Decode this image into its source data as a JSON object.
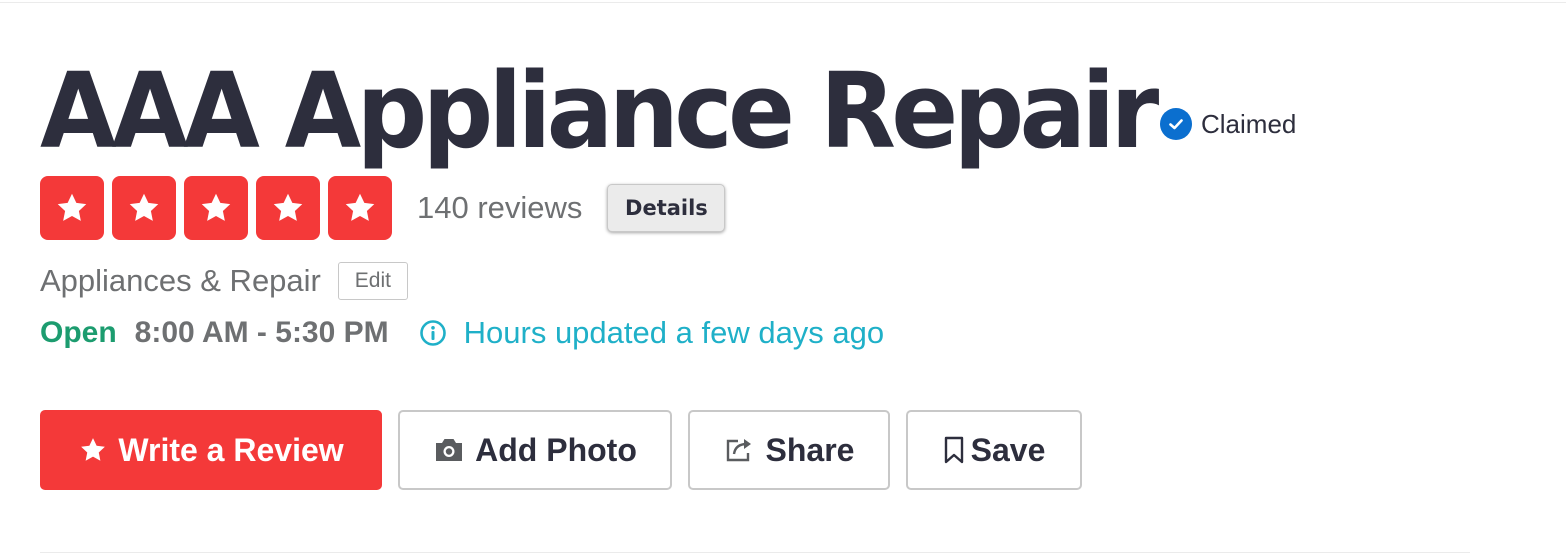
{
  "business": {
    "name": "AAA Appliance Repair",
    "claimed_label": "Claimed"
  },
  "rating": {
    "stars": 5,
    "max_stars": 5,
    "review_count_label": "140 reviews",
    "details_label": "Details"
  },
  "category": {
    "label": "Appliances & Repair",
    "edit_label": "Edit"
  },
  "hours": {
    "status": "Open",
    "range": "8:00 AM - 5:30 PM",
    "updated_note": "Hours updated a few days ago"
  },
  "actions": {
    "write_review": "Write a Review",
    "add_photo": "Add Photo",
    "share": "Share",
    "save": "Save"
  },
  "icons": {
    "claimed": "check-circle-icon",
    "star": "star-icon",
    "info": "info-icon",
    "camera": "camera-icon",
    "share": "share-icon",
    "bookmark": "bookmark-icon"
  },
  "colors": {
    "brand_red": "#f43939",
    "open_green": "#1c9c6f",
    "link_teal": "#1fb0c8",
    "verified_blue": "#0b6fcf",
    "text_dark": "#2d2e3d",
    "text_muted": "#6e7072"
  }
}
